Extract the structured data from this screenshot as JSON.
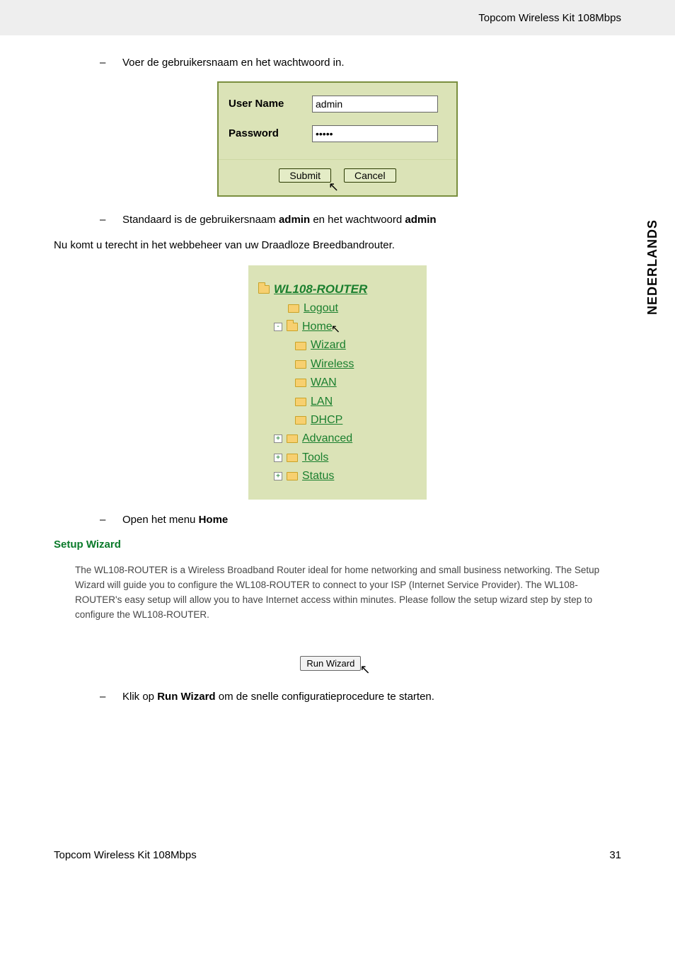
{
  "header": {
    "title": "Topcom Wireless Kit 108Mbps"
  },
  "side_tab": "NEDERLANDS",
  "instructions": {
    "enter_creds": "Voer de gebruikersnaam en het wachtwoord in.",
    "default_creds_prefix": "Standaard is de gebruikersnaam ",
    "default_creds_mid": " en het wachtwoord ",
    "admin_word": "admin",
    "web_admin_intro": "Nu komt u terecht in het webbeheer van uw Draadloze Breedbandrouter.",
    "open_menu_prefix": "Open het menu ",
    "open_menu_bold": "Home",
    "click_prefix": "Klik op ",
    "run_wizard_bold": "Run Wizard",
    "click_suffix": " om de snelle configuratieprocedure te starten."
  },
  "login": {
    "username_label": "User Name",
    "password_label": "Password",
    "username_value": "admin",
    "password_value": "•••••",
    "submit_label": "Submit",
    "cancel_label": "Cancel"
  },
  "tree": {
    "root": "WL108-ROUTER",
    "logout": "Logout",
    "home": "Home",
    "home_children": {
      "wizard": "Wizard",
      "wireless": "Wireless",
      "wan": "WAN",
      "lan": "LAN",
      "dhcp": "DHCP"
    },
    "advanced": "Advanced",
    "tools": "Tools",
    "status": "Status"
  },
  "wizard": {
    "heading": "Setup Wizard",
    "desc": "The WL108-ROUTER is a Wireless Broadband Router ideal for home networking and small business networking. The Setup Wizard will guide you to configure the WL108-ROUTER to connect to your ISP (Internet Service Provider). The WL108-ROUTER's easy setup will allow you to have Internet access within minutes. Please follow the setup wizard step by step to configure the WL108-ROUTER.",
    "run_label": "Run Wizard"
  },
  "footer": {
    "left": "Topcom Wireless Kit 108Mbps",
    "page_no": "31"
  }
}
